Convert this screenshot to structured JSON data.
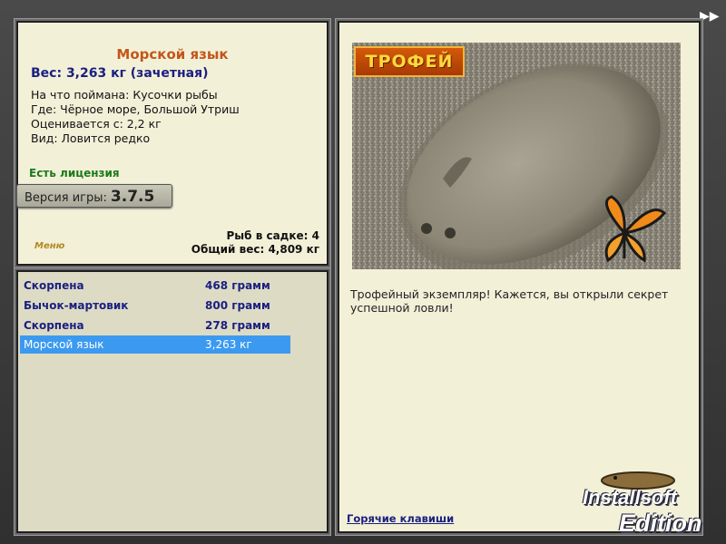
{
  "fish": {
    "title": "Морской язык",
    "weight": "Вес: 3,263 кг (зачетная)",
    "bait": "На что поймана: Кусочки рыбы",
    "location": "Где: Чёрное море, Большой Утриш",
    "value": "Оценивается с: 2,2 кг",
    "rarity": "Вид: Ловится редко"
  },
  "license": "Есть лицензия",
  "version": {
    "label": "Версия игры:",
    "number": "3.7.5"
  },
  "menu_label": "Меню",
  "stats": {
    "count": "Рыб в садке: 4",
    "total": "Общий вес: 4,809 кг"
  },
  "catch_list": [
    {
      "name": "Скорпена",
      "weight": "468 грамм"
    },
    {
      "name": "Бычок-мартовик",
      "weight": "800 грамм"
    },
    {
      "name": "Скорпена",
      "weight": "278 грамм"
    },
    {
      "name": "Морской язык",
      "weight": "3,263 кг"
    }
  ],
  "detail": {
    "badge": "ТРОФЕЙ",
    "description": "Трофейный экземпляр! Кажется, вы открыли секрет успешной ловли!",
    "hotkeys": "Горячие клавиши"
  },
  "logo": {
    "line1": "Installsoft",
    "line2": "Edition"
  },
  "colors": {
    "title": "#c2561a",
    "weight": "#1a2080",
    "license": "#1c7a1c",
    "selected": "#3b9af0"
  },
  "icons": {
    "forward": "fast-forward-icon"
  }
}
